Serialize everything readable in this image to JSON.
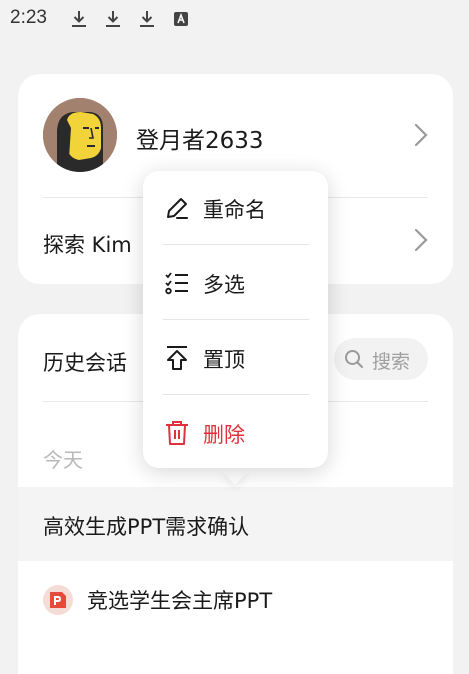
{
  "status_bar": {
    "time": "2:23",
    "icons": [
      "download-icon",
      "download-icon",
      "download-icon",
      "font-a-icon"
    ]
  },
  "profile": {
    "username": "登月者2633",
    "explore_label": "探索 Kim"
  },
  "history": {
    "title": "历史会话",
    "search_placeholder": "搜索",
    "section_today": "今天",
    "conversations": [
      {
        "title": "高效生成PPT需求确认",
        "active": true
      },
      {
        "title": "竞选学生会主席PPT",
        "icon": "ppt-icon",
        "active": false
      }
    ]
  },
  "context_menu": {
    "items": [
      {
        "label": "重命名",
        "icon": "pencil-icon"
      },
      {
        "label": "多选",
        "icon": "checklist-icon"
      },
      {
        "label": "置顶",
        "icon": "pin-top-icon"
      },
      {
        "label": "删除",
        "icon": "trash-icon",
        "danger": true
      }
    ]
  },
  "colors": {
    "background": "#f2f2f2",
    "card": "#ffffff",
    "danger": "#e0323e",
    "avatar_bg": "#a2826f",
    "avatar_face": "#f2d33a",
    "ppt_red": "#e84a3a"
  }
}
